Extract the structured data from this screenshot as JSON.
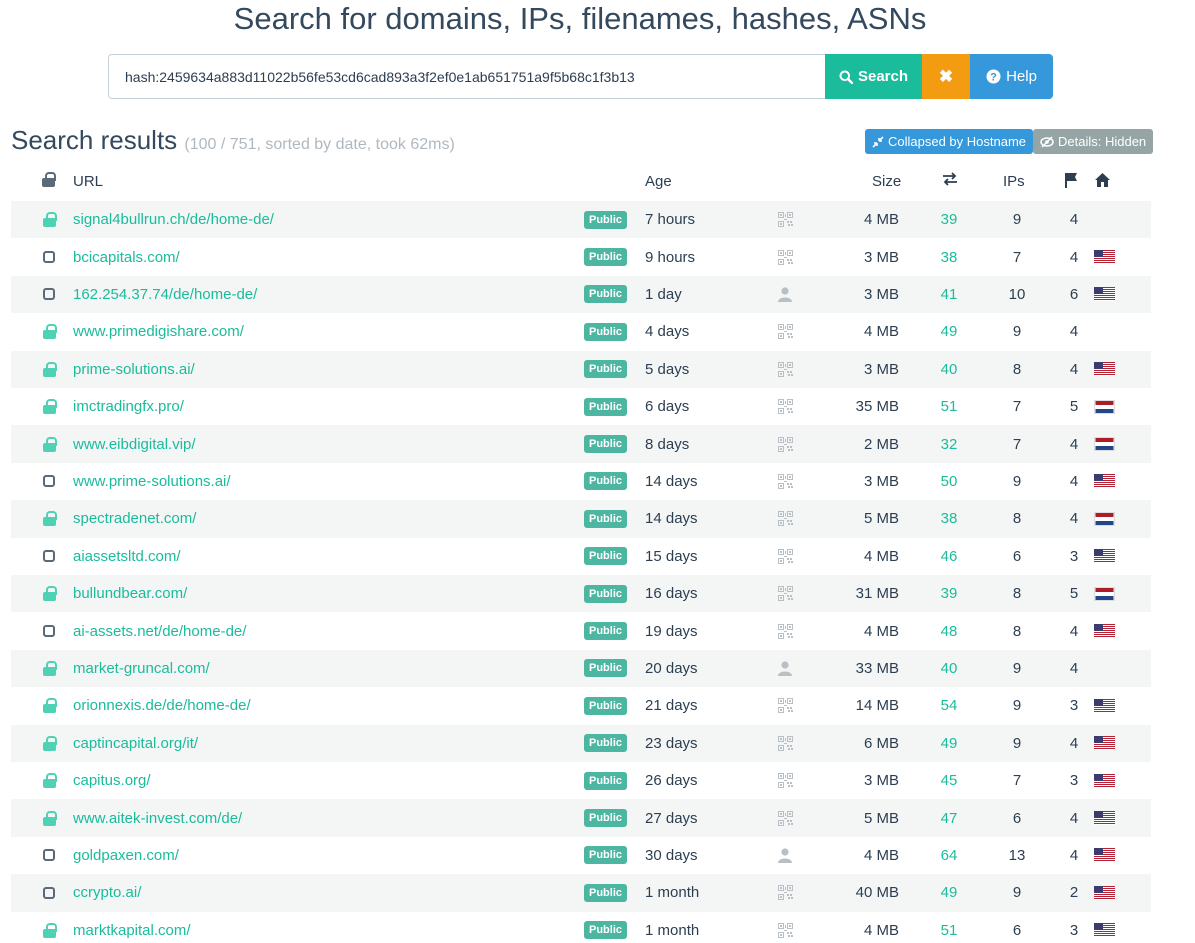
{
  "header": {
    "title": "Search for domains, IPs, filenames, hashes, ASNs"
  },
  "search": {
    "value": "hash:2459634a883d11022b56fe53cd6cad893a3f2ef0e1ab651751a9f5b68c1f3b13",
    "search_label": "Search",
    "clear_label": "✖",
    "help_label": "Help"
  },
  "results": {
    "title": "Search results",
    "meta": "(100 / 751, sorted by date, took 62ms)",
    "collapse_label": "Collapsed by Hostname",
    "details_label": "Details: Hidden"
  },
  "columns": {
    "url": "URL",
    "age": "Age",
    "size": "Size",
    "ips": "IPs"
  },
  "colors": {
    "accent": "#1abc9c",
    "warning": "#f39c12",
    "info": "#3498db",
    "muted": "#95a5a6"
  },
  "rows": [
    {
      "secure": true,
      "url": "signal4bullrun.ch/de/home-de/",
      "badge": "Public",
      "age": "7 hours",
      "icon": "qr",
      "size": "4 MB",
      "requests": "39",
      "ips": "9",
      "countries": "4",
      "flag": ""
    },
    {
      "secure": false,
      "url": "bcicapitals.com/",
      "badge": "Public",
      "age": "9 hours",
      "icon": "qr",
      "size": "3 MB",
      "requests": "38",
      "ips": "7",
      "countries": "4",
      "flag": "us"
    },
    {
      "secure": false,
      "url": "162.254.37.74/de/home-de/",
      "badge": "Public",
      "age": "1 day",
      "icon": "user",
      "size": "3 MB",
      "requests": "41",
      "ips": "10",
      "countries": "6",
      "flag": "us"
    },
    {
      "secure": true,
      "url": "www.primedigishare.com/",
      "badge": "Public",
      "age": "4 days",
      "icon": "qr",
      "size": "4 MB",
      "requests": "49",
      "ips": "9",
      "countries": "4",
      "flag": ""
    },
    {
      "secure": true,
      "url": "prime-solutions.ai/",
      "badge": "Public",
      "age": "5 days",
      "icon": "qr",
      "size": "3 MB",
      "requests": "40",
      "ips": "8",
      "countries": "4",
      "flag": "us"
    },
    {
      "secure": true,
      "url": "imctradingfx.pro/",
      "badge": "Public",
      "age": "6 days",
      "icon": "qr",
      "size": "35 MB",
      "requests": "51",
      "ips": "7",
      "countries": "5",
      "flag": "nl"
    },
    {
      "secure": true,
      "url": "www.eibdigital.vip/",
      "badge": "Public",
      "age": "8 days",
      "icon": "qr",
      "size": "2 MB",
      "requests": "32",
      "ips": "7",
      "countries": "4",
      "flag": "nl"
    },
    {
      "secure": false,
      "url": "www.prime-solutions.ai/",
      "badge": "Public",
      "age": "14 days",
      "icon": "qr",
      "size": "3 MB",
      "requests": "50",
      "ips": "9",
      "countries": "4",
      "flag": "us"
    },
    {
      "secure": true,
      "url": "spectradenet.com/",
      "badge": "Public",
      "age": "14 days",
      "icon": "qr",
      "size": "5 MB",
      "requests": "38",
      "ips": "8",
      "countries": "4",
      "flag": "nl"
    },
    {
      "secure": false,
      "url": "aiassetsltd.com/",
      "badge": "Public",
      "age": "15 days",
      "icon": "qr",
      "size": "4 MB",
      "requests": "46",
      "ips": "6",
      "countries": "3",
      "flag": "us"
    },
    {
      "secure": true,
      "url": "bullundbear.com/",
      "badge": "Public",
      "age": "16 days",
      "icon": "qr",
      "size": "31 MB",
      "requests": "39",
      "ips": "8",
      "countries": "5",
      "flag": "nl"
    },
    {
      "secure": false,
      "url": "ai-assets.net/de/home-de/",
      "badge": "Public",
      "age": "19 days",
      "icon": "qr",
      "size": "4 MB",
      "requests": "48",
      "ips": "8",
      "countries": "4",
      "flag": "us"
    },
    {
      "secure": true,
      "url": "market-gruncal.com/",
      "badge": "Public",
      "age": "20 days",
      "icon": "user",
      "size": "33 MB",
      "requests": "40",
      "ips": "9",
      "countries": "4",
      "flag": ""
    },
    {
      "secure": true,
      "url": "orionnexis.de/de/home-de/",
      "badge": "Public",
      "age": "21 days",
      "icon": "qr",
      "size": "14 MB",
      "requests": "54",
      "ips": "9",
      "countries": "3",
      "flag": "us"
    },
    {
      "secure": true,
      "url": "captincapital.org/it/",
      "badge": "Public",
      "age": "23 days",
      "icon": "qr",
      "size": "6 MB",
      "requests": "49",
      "ips": "9",
      "countries": "4",
      "flag": "us"
    },
    {
      "secure": true,
      "url": "capitus.org/",
      "badge": "Public",
      "age": "26 days",
      "icon": "qr",
      "size": "3 MB",
      "requests": "45",
      "ips": "7",
      "countries": "3",
      "flag": "us"
    },
    {
      "secure": true,
      "url": "www.aitek-invest.com/de/",
      "badge": "Public",
      "age": "27 days",
      "icon": "qr",
      "size": "5 MB",
      "requests": "47",
      "ips": "6",
      "countries": "4",
      "flag": "us"
    },
    {
      "secure": false,
      "url": "goldpaxen.com/",
      "badge": "Public",
      "age": "30 days",
      "icon": "user",
      "size": "4 MB",
      "requests": "64",
      "ips": "13",
      "countries": "4",
      "flag": "us"
    },
    {
      "secure": false,
      "url": "ccrypto.ai/",
      "badge": "Public",
      "age": "1 month",
      "icon": "qr",
      "size": "40 MB",
      "requests": "49",
      "ips": "9",
      "countries": "2",
      "flag": "us"
    },
    {
      "secure": true,
      "url": "marktkapital.com/",
      "badge": "Public",
      "age": "1 month",
      "icon": "qr",
      "size": "4 MB",
      "requests": "51",
      "ips": "6",
      "countries": "3",
      "flag": "us"
    }
  ]
}
